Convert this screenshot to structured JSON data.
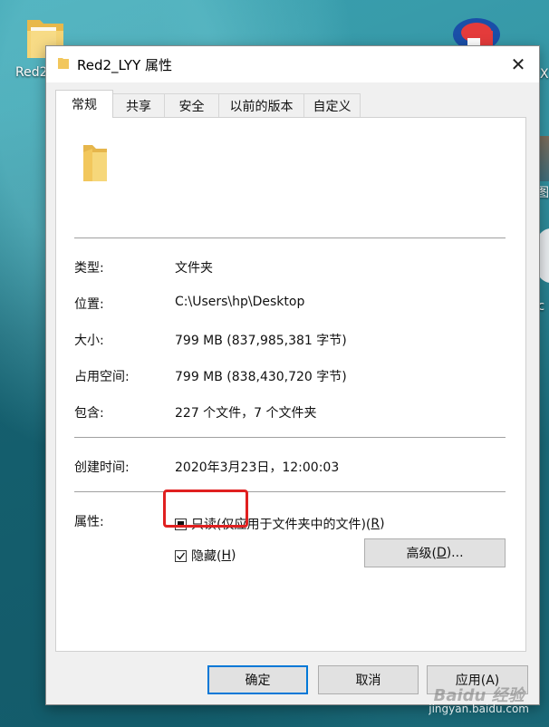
{
  "desktop": {
    "left_icon_label": "Red2",
    "right_label_top": "X",
    "right_label_mid": "图",
    "right_label_low": "rc"
  },
  "dialog": {
    "title": "Red2_LYY 属性",
    "close_glyph": "✕"
  },
  "tabs": [
    {
      "label": "常规",
      "active": true
    },
    {
      "label": "共享"
    },
    {
      "label": "安全"
    },
    {
      "label": "以前的版本"
    },
    {
      "label": "自定义"
    }
  ],
  "general": {
    "type_label": "类型:",
    "type_value": "文件夹",
    "location_label": "位置:",
    "location_value": "C:\\Users\\hp\\Desktop",
    "size_label": "大小:",
    "size_value": "799 MB (837,985,381 字节)",
    "disk_label": "占用空间:",
    "disk_value": "799 MB (838,430,720 字节)",
    "contains_label": "包含:",
    "contains_value": "227 个文件，7 个文件夹",
    "created_label": "创建时间:",
    "created_value": "2020年3月23日，12:00:03",
    "attributes_label": "属性:",
    "readonly_label": "只读(仅应用于文件夹中的文件)(",
    "readonly_key": "R",
    "readonly_tail": ")",
    "readonly_state": "indeterminate",
    "hidden_label": "隐藏(",
    "hidden_key": "H",
    "hidden_tail": ")",
    "hidden_checked": true,
    "advanced_label": "高级(",
    "advanced_key": "D",
    "advanced_tail": ")..."
  },
  "footer": {
    "ok": "确定",
    "cancel": "取消",
    "apply": "应用(A)"
  },
  "watermark": {
    "line1": "Baidu 经验",
    "line2": "jingyan.baidu.com"
  },
  "colors": {
    "highlight": "#e02020",
    "focus": "#0078d7",
    "folder": "#f2c75c"
  }
}
